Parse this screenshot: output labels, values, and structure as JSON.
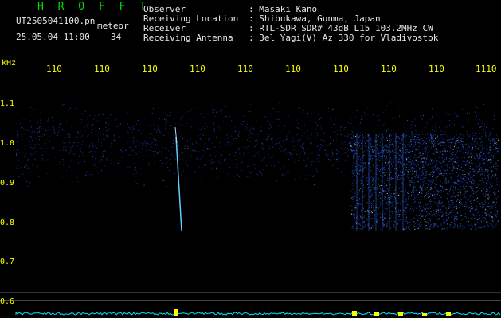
{
  "header": {
    "brand": "H R O F F T",
    "file_name": "UT2505041100.pn",
    "tag": "meteor",
    "datetime": "25.05.04 11:00",
    "count": "34"
  },
  "info": [
    {
      "label": "Observer",
      "value": ": Masaki Kano"
    },
    {
      "label": "Receiving Location",
      "value": ": Shibukawa, Gunma, Japan"
    },
    {
      "label": "Receiver",
      "value": ": RTL-SDR SDR# 43dB L15 103.2MHz CW"
    },
    {
      "label": "Receiving Antenna",
      "value": ": 3el Yagi(V) Az 330 for Vladivostok"
    }
  ],
  "chart_data": {
    "type": "heatmap",
    "y_unit": "kHz",
    "y_ticks": [
      "1.1",
      "1.0",
      "0.9",
      "0.8",
      "0.7",
      "0.6"
    ],
    "x_ticks": [
      "110",
      "110",
      "110",
      "110",
      "110",
      "110",
      "110",
      "110",
      "110",
      "1110"
    ],
    "colors": {
      "axis_text": "#ffff00",
      "signal": "#1e50ff",
      "meteor_trail": "#66ccff",
      "baseline": "#00e5ff"
    }
  }
}
